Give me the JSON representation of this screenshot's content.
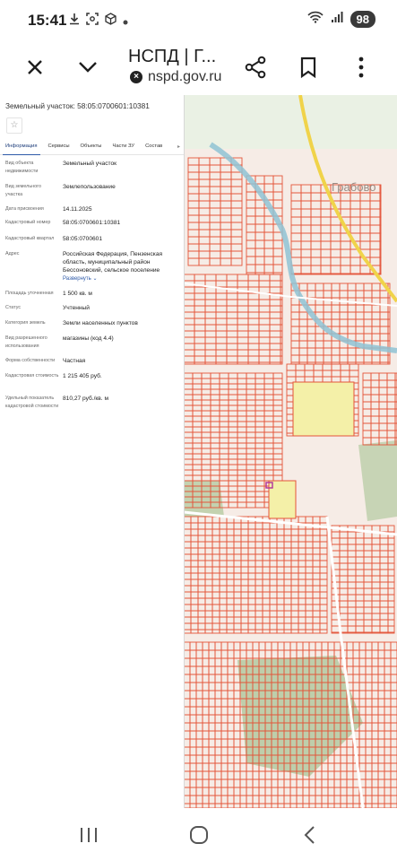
{
  "status_bar": {
    "time": "15:41",
    "battery": "98",
    "left_icons": [
      "download-icon",
      "screenshot-icon",
      "cube-icon",
      "dot-icon"
    ],
    "right_icons": [
      "wifi-icon",
      "signal-icon"
    ]
  },
  "browser": {
    "page_title": "НСПД | Г...",
    "url": "nspd.gov.ru",
    "buttons": [
      "close-icon",
      "chevron-down-icon",
      "share-icon",
      "bookmark-icon",
      "more-icon"
    ]
  },
  "panel": {
    "title": "Земельный участок: 58:05:0700601:10381",
    "tabs": [
      "Информация",
      "Сервисы",
      "Объекты",
      "Части ЗУ",
      "Состав"
    ],
    "active_tab": "Информация",
    "fields": [
      {
        "label": "Вид объекта недвижимости",
        "value": "Земельный участок"
      },
      {
        "label": "Вид земельного участка",
        "value": "Землепользование"
      },
      {
        "label": "Дата присвоения",
        "value": "14.11.2025"
      },
      {
        "label": "Кадастровый номер",
        "value": "58:05:0700601:10381"
      },
      {
        "label": "Кадастровый квартал",
        "value": "58:05:0700601"
      },
      {
        "label": "Адрес",
        "value": "Российская Федерация, Пензенская область, муниципальный район Бессоновский, сельское поселение"
      },
      {
        "label": "Площадь уточненная",
        "value": "1 500 кв. м"
      },
      {
        "label": "Статус",
        "value": "Учтенный"
      },
      {
        "label": "Категория земель",
        "value": "Земли населенных пунктов"
      },
      {
        "label": "Вид разрешенного использования",
        "value": "магазины (код 4.4)"
      },
      {
        "label": "Форма собственности",
        "value": "Частная"
      },
      {
        "label": "Кадастровая стоимость",
        "value": "1 215 405 руб."
      },
      {
        "label": "Удельный показатель кадастровой стоимости",
        "value": "810,27 руб./кв. м"
      }
    ],
    "expand_link": "Развернуть"
  },
  "map": {
    "place_label": "Грабово",
    "colors": {
      "parcel": "#e4553a",
      "background": "#f6ece6",
      "water": "#8fc3d4",
      "green": "#8fb77a",
      "highlight": "#f4f0a8",
      "road": "#f0d34a"
    }
  },
  "nav_bar": {
    "buttons": [
      "recent-apps-icon",
      "home-icon",
      "back-icon"
    ]
  }
}
